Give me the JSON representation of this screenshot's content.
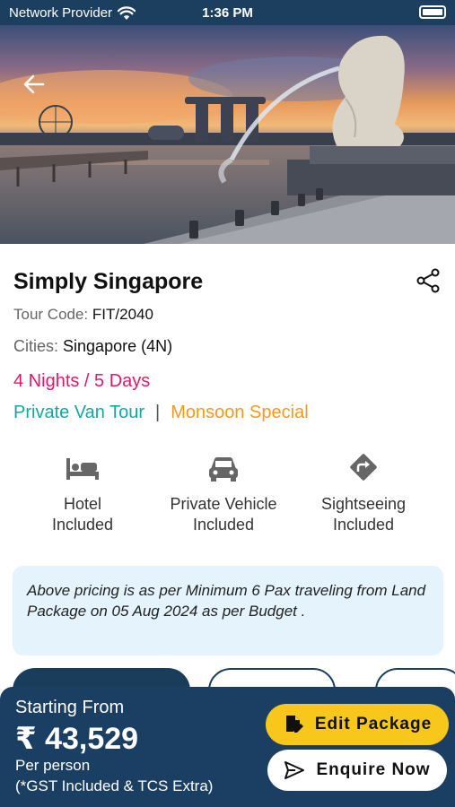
{
  "status_bar": {
    "carrier": "Network Provider",
    "time": "1:36 PM",
    "icons": [
      "wifi-icon",
      "battery-icon"
    ]
  },
  "hero": {
    "image_subject": "Marina Bay with Merlion statue at sunset",
    "back_icon": "arrow-left-icon"
  },
  "package": {
    "title": "Simply Singapore",
    "share_icon": "share-icon",
    "tour_code_label": "Tour Code:",
    "tour_code_value": "FIT/2040",
    "cities_label": "Cities:",
    "cities_value": "Singapore (4N)",
    "duration": "4 Nights / 5 Days",
    "tags": {
      "tour_type": "Private Van Tour",
      "separator": "|",
      "special": "Monsoon Special"
    }
  },
  "features": [
    {
      "icon": "bed-icon",
      "line1": "Hotel",
      "line2": "Included"
    },
    {
      "icon": "car-icon",
      "line1": "Private Vehicle",
      "line2": "Included"
    },
    {
      "icon": "directions-icon",
      "line1": "Sightseeing",
      "line2": "Included"
    }
  ],
  "note": {
    "text": "Above pricing is as per Minimum 6 Pax traveling from Land Package  on 05 Aug 2024 as per Budget ."
  },
  "footer": {
    "starting_from": "Starting From",
    "price": "₹ 43,529",
    "per_person": "Per person",
    "tax_note": "(*GST Included & TCS Extra)",
    "edit_button": "Edit Package",
    "enquire_button": "Enquire Now"
  },
  "colors": {
    "primary": "#1b3f62",
    "duration": "#e0186b",
    "tour_type": "#13a89e",
    "special": "#f39a1c",
    "edit_button_bg": "#f7c71b",
    "note_bg": "#e5f3fc"
  }
}
